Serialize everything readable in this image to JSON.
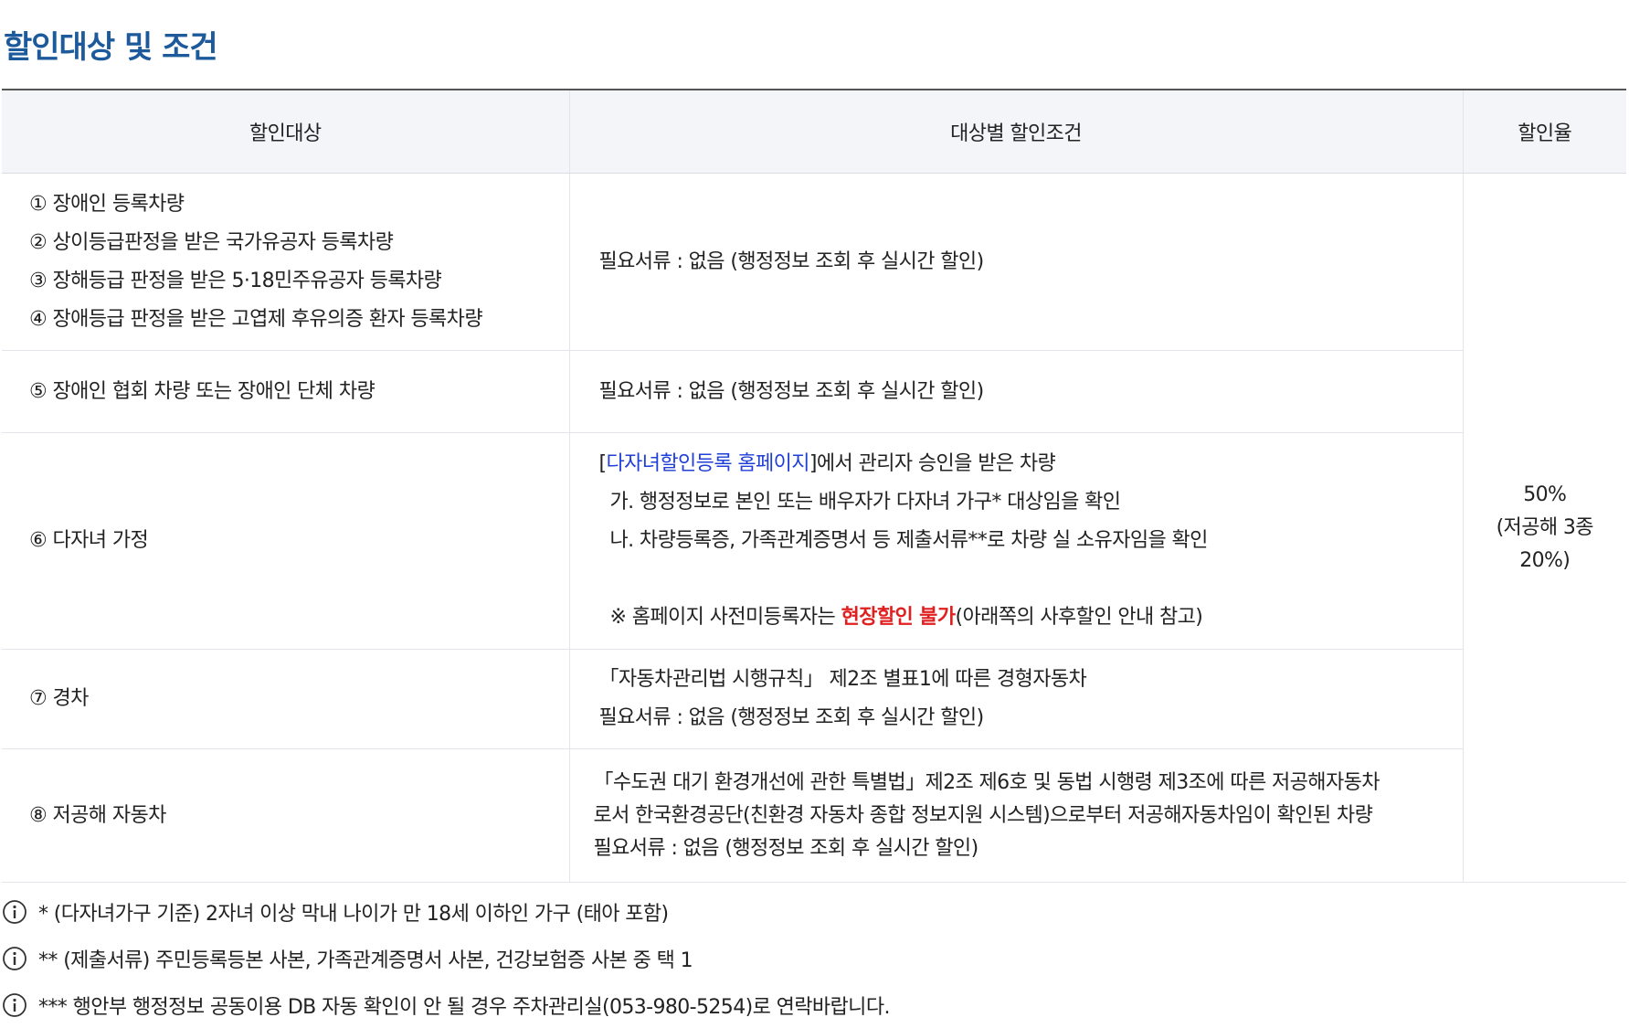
{
  "section": {
    "title": "할인대상 및 조건"
  },
  "table": {
    "headers": {
      "target": "할인대상",
      "condition": "대상별 할인조건",
      "rate": "할인율"
    },
    "rate": {
      "line1": "50%",
      "line2": "(저공해 3종",
      "line3": "20%)"
    },
    "rows": [
      {
        "targets": [
          "① 장애인 등록차량",
          "② 상이등급판정을 받은 국가유공자 등록차량",
          "③ 장해등급 판정을 받은 5·18민주유공자 등록차량",
          "④ 장애등급 판정을 받은 고엽제 후유의증 환자 등록차량"
        ],
        "condition": "필요서류 : 없음 (행정정보 조회 후 실시간 할인)"
      },
      {
        "target": "⑤ 장애인 협회 차량 또는 장애인 단체 차량",
        "condition": "필요서류 : 없음 (행정정보 조회 후 실시간 할인)"
      },
      {
        "target": "⑥ 다자녀 가정",
        "link_open": "[",
        "link_text": "다자녀할인등록 홈페이지",
        "link_close": "]에서 관리자 승인을 받은 차량",
        "item_a": "가. 행정정보로 본인 또는 배우자가 다자녀 가구* 대상임을 확인",
        "item_b": "나. 차량등록증, 가족관계증명서 등 제출서류**로 차량 실 소유자임을 확인",
        "notice_prefix": "※ 홈페이지 사전미등록자는 ",
        "notice_highlight": "현장할인 불가",
        "notice_suffix": "(아래쪽의 사후할인 안내 참고)"
      },
      {
        "target": "⑦ 경차",
        "condition_line1": "「자동차관리법 시행규칙」 제2조 별표1에 따른 경형자동차",
        "condition_line2": "필요서류 : 없음 (행정정보 조회 후 실시간 할인)"
      },
      {
        "target": "⑧ 저공해 자동차",
        "condition_line1": "「수도권 대기 환경개선에 관한 특별법」제2조 제6호 및 동법 시행령 제3조에 따른 저공해자동차",
        "condition_line2": "로서 한국환경공단(친환경 자동차 종합 정보지원 시스템)으로부터 저공해자동차임이 확인된 차량",
        "condition_line3": "필요서류 : 없음 (행정정보 조회 후 실시간 할인)"
      }
    ]
  },
  "notes": [
    {
      "icon": "info-icon",
      "text": "* (다자녀가구 기준) 2자녀 이상 막내 나이가 만 18세 이하인 가구 (태아 포함)"
    },
    {
      "icon": "info-icon",
      "text": "** (제출서류) 주민등록등본 사본, 가족관계증명서 사본, 건강보험증 사본 중 택 1"
    },
    {
      "icon": "info-icon",
      "text": "*** 행안부 행정정보 공동이용 DB 자동 확인이 안 될 경우 주차관리실(053-980-5254)로 연락바랍니다."
    }
  ],
  "colors": {
    "title": "#1d5a9c",
    "link": "#1f3fd6",
    "warning": "#e02020",
    "header_bg": "#f3f5f8"
  }
}
